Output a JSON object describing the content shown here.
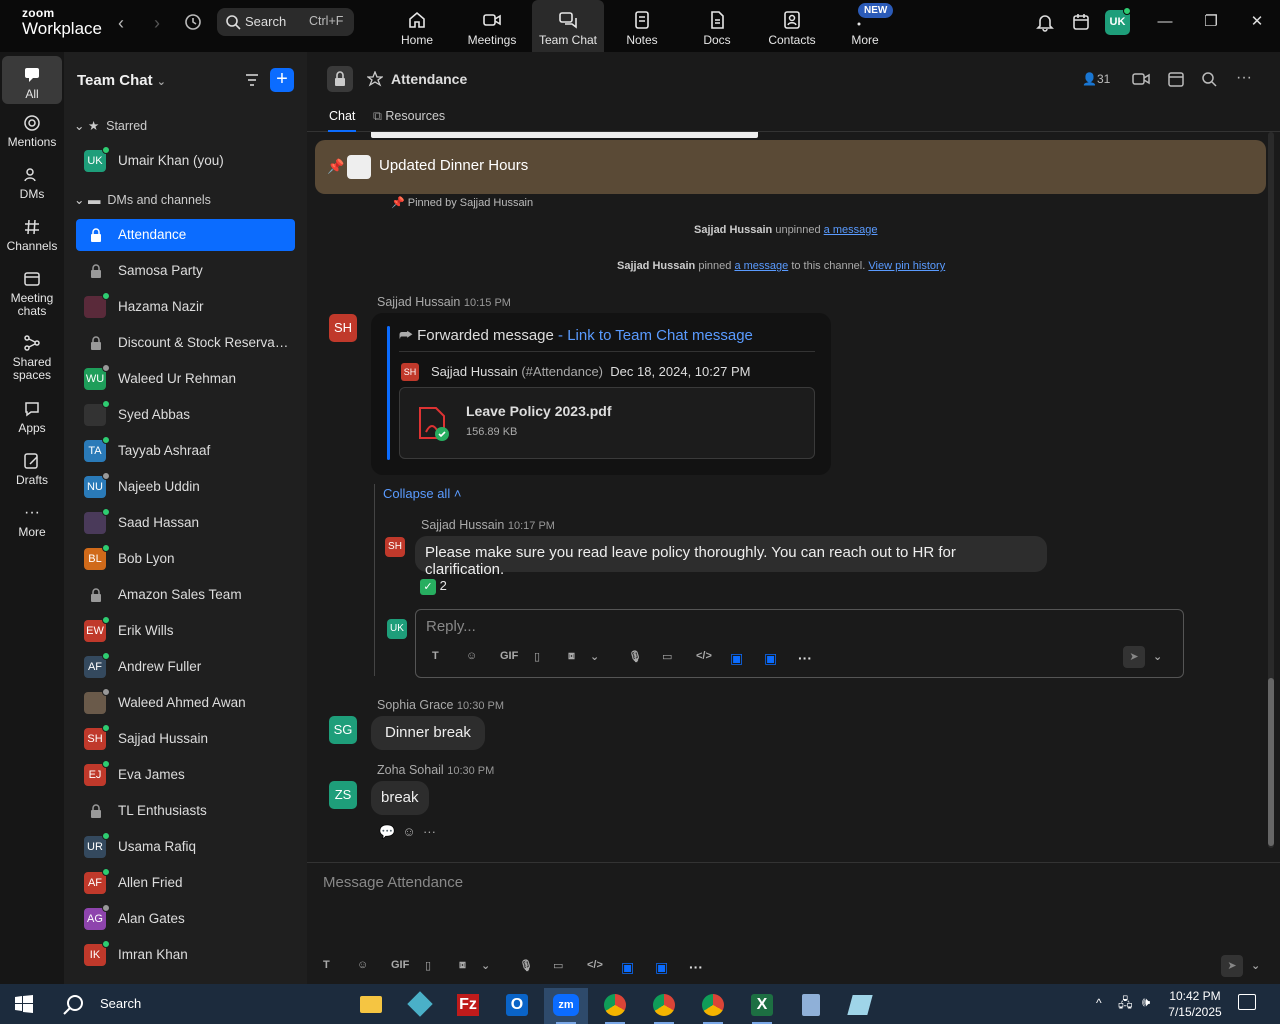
{
  "app": {
    "brand_small": "zoom",
    "brand_big": "Workplace"
  },
  "search": {
    "label": "Search",
    "shortcut": "Ctrl+F"
  },
  "tabs": [
    {
      "label": "Home"
    },
    {
      "label": "Meetings"
    },
    {
      "label": "Team Chat"
    },
    {
      "label": "Notes"
    },
    {
      "label": "Docs"
    },
    {
      "label": "Contacts"
    },
    {
      "label": "More"
    }
  ],
  "new_badge": "NEW",
  "user_initials": "UK",
  "rail": [
    {
      "label": "All"
    },
    {
      "label": "Mentions"
    },
    {
      "label": "DMs"
    },
    {
      "label": "Channels"
    },
    {
      "label": "Meeting chats"
    },
    {
      "label": "Shared spaces"
    },
    {
      "label": "Apps"
    },
    {
      "label": "Drafts"
    },
    {
      "label": "More"
    }
  ],
  "sidebar": {
    "title": "Team Chat",
    "starred_label": "Starred",
    "dms_label": "DMs and channels",
    "starred": [
      {
        "initials": "UK",
        "name": "Umair Khan (you)",
        "color": "#1e9e7a"
      }
    ],
    "items": [
      {
        "name": "Attendance",
        "type": "lock",
        "active": true
      },
      {
        "name": "Samosa Party",
        "type": "lock"
      },
      {
        "name": "Hazama Nazir",
        "type": "photo",
        "color": "#5a2a3a"
      },
      {
        "name": "Discount & Stock Reservati...",
        "type": "lock"
      },
      {
        "initials": "WU",
        "name": "Waleed Ur Rehman",
        "color": "#1e9e5a"
      },
      {
        "name": "Syed Abbas",
        "type": "photo",
        "color": "#333"
      },
      {
        "initials": "TA",
        "name": "Tayyab Ashraaf",
        "color": "#2a7ab8"
      },
      {
        "initials": "NU",
        "name": "Najeeb Uddin",
        "color": "#2a7ab8"
      },
      {
        "name": "Saad Hassan",
        "type": "photo",
        "color": "#4a3a5a"
      },
      {
        "initials": "BL",
        "name": "Bob Lyon",
        "color": "#d06a1a"
      },
      {
        "name": "Amazon Sales Team",
        "type": "lock"
      },
      {
        "initials": "EW",
        "name": "Erik Wills",
        "color": "#c0392b"
      },
      {
        "initials": "AF",
        "name": "Andrew Fuller",
        "color": "#34495e"
      },
      {
        "name": "Waleed Ahmed Awan",
        "type": "photo",
        "color": "#6a5a4a"
      },
      {
        "initials": "SH",
        "name": "Sajjad Hussain",
        "color": "#c0392b"
      },
      {
        "initials": "EJ",
        "name": "Eva James",
        "color": "#c0392b"
      },
      {
        "name": "TL Enthusiasts",
        "type": "lock"
      },
      {
        "initials": "UR",
        "name": "Usama Rafiq",
        "color": "#34495e"
      },
      {
        "initials": "AF",
        "name": "Allen Fried",
        "color": "#c0392b"
      },
      {
        "initials": "AG",
        "name": "Alan Gates",
        "color": "#8e44ad"
      },
      {
        "initials": "IK",
        "name": "Imran Khan",
        "color": "#c0392b"
      }
    ]
  },
  "channel": {
    "title": "Attendance",
    "member_count": "31",
    "tabs": [
      {
        "label": "Chat"
      },
      {
        "label": "Resources"
      }
    ]
  },
  "pin": {
    "title": "Updated Dinner Hours",
    "pinned_by": "Pinned by Sajjad Hussain"
  },
  "system": [
    {
      "actor": "Sajjad Hussain",
      "pre": "unpinned",
      "link": "a message",
      "post": "",
      "link2": ""
    },
    {
      "actor": "Sajjad Hussain",
      "pre": "pinned",
      "link": "a message",
      "post": "to this channel.",
      "link2": "View pin history"
    }
  ],
  "forward": {
    "sender": "Sajjad Hussain",
    "time": "10:15 PM",
    "initials": "SH",
    "label": "Forwarded message",
    "link": "Link to Team Chat message",
    "orig_sender": "Sajjad Hussain",
    "orig_channel": "(#Attendance)",
    "orig_date": "Dec 18, 2024, 10:27 PM",
    "file_name": "Leave Policy 2023.pdf",
    "file_size": "156.89 KB"
  },
  "thread": {
    "collapse": "Collapse all",
    "reply_sender": "Sajjad Hussain",
    "reply_time": "10:17 PM",
    "reply_text": "Please make sure you read leave policy thoroughly. You can reach out to HR for clarification.",
    "reaction_count": "2",
    "reply_placeholder": "Reply..."
  },
  "messages": [
    {
      "sender": "Sophia Grace",
      "time": "10:30 PM",
      "initials": "SG",
      "color": "#1e9e7a",
      "text": "Dinner break"
    },
    {
      "sender": "Zoha Sohail",
      "time": "10:30 PM",
      "initials": "ZS",
      "color": "#1e9e7a",
      "text": "break"
    }
  ],
  "composer": {
    "placeholder": "Message Attendance"
  },
  "gif_label": "GIF",
  "taskbar": {
    "search": "Search",
    "time": "10:42 PM",
    "date": "7/15/2025"
  }
}
